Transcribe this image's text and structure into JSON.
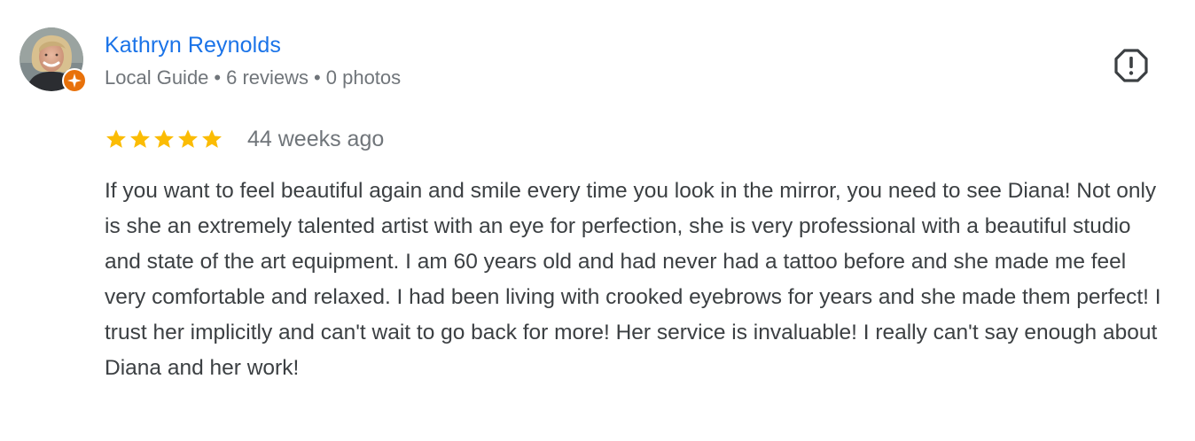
{
  "reviewer": {
    "name": "Kathryn Reynolds",
    "guide_label": "Local Guide",
    "separator": "•",
    "reviews": "6 reviews",
    "photos": "0 photos"
  },
  "review": {
    "rating": 5,
    "max_rating": 5,
    "date": "44 weeks ago",
    "text": "If you want to feel beautiful again and smile every time you look in the mirror, you need to see Diana! Not only is she an extremely talented artist with an eye for perfection, she is very professional with a beautiful studio and state of the art equipment. I am 60 years old and had never had a tattoo before and she made me feel very comfortable and relaxed. I had been living with crooked eyebrows for years and she made them perfect! I trust her implicitly and can't wait to go back for more! Her service is invaluable! I really can't say enough about Diana and her work!"
  },
  "icons": {
    "avatar": "avatar-photo",
    "badge": "local-guide-badge-icon",
    "report": "report-flag-icon",
    "star": "star-icon"
  },
  "colors": {
    "name_link": "#1a73e8",
    "meta_text": "#70757a",
    "body_text": "#3c4043",
    "star_fill": "#fbbc04",
    "badge_orange": "#e8710a",
    "report_icon": "#3c4043"
  }
}
